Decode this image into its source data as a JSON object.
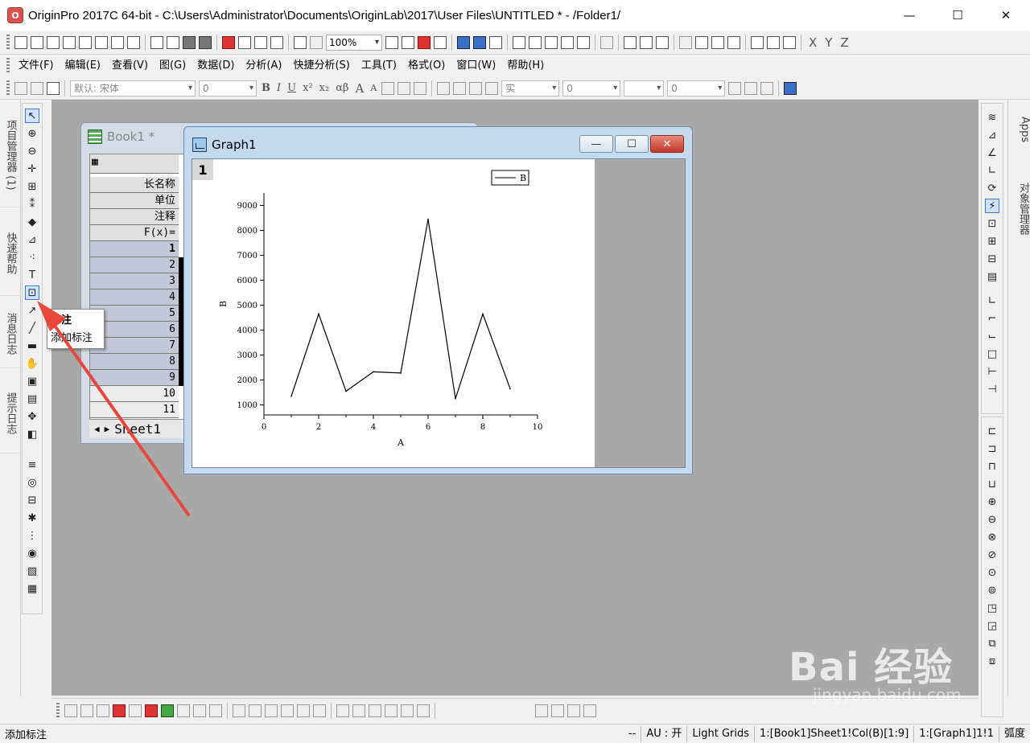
{
  "window": {
    "title": "OriginPro 2017C 64-bit - C:\\Users\\Administrator\\Documents\\OriginLab\\2017\\User Files\\UNTITLED * - /Folder1/",
    "minimize_symbol": "—",
    "maximize_symbol": "☐",
    "close_symbol": "✕"
  },
  "toolbar": {
    "zoom_value": "100%",
    "font_name": "默认: 宋体",
    "font_size": "0",
    "line_style": "实",
    "line_width": "0",
    "line_width_2": "0",
    "italic_label": "I",
    "bold_label": "B",
    "underline_label": "U",
    "superscript_label": "x²",
    "subscript_label": "x₂",
    "greek_label": "αβ",
    "increase_font_label": "A",
    "decrease_font_label": "A",
    "x_label": "X",
    "y_label": "Y",
    "z_label": "Z"
  },
  "menubar": {
    "items": [
      "文件(F)",
      "编辑(E)",
      "查看(V)",
      "图(G)",
      "数据(D)",
      "分析(A)",
      "快捷分析(S)",
      "工具(T)",
      "格式(O)",
      "窗口(W)",
      "帮助(H)"
    ]
  },
  "left_dock": {
    "tabs": [
      "项目管理器 (1)",
      "快速帮助",
      "消息日志",
      "提示日志"
    ]
  },
  "right_dock": {
    "tabs": [
      "Apps",
      "对象管理器"
    ]
  },
  "book": {
    "title": "Book1 *",
    "header_rows": [
      "长名称",
      "单位",
      "注释",
      "F(x)="
    ],
    "row_numbers": [
      "1",
      "2",
      "3",
      "4",
      "5",
      "6",
      "7",
      "8",
      "9",
      "10",
      "11"
    ],
    "sheet_tab": "Sheet1"
  },
  "graph": {
    "title": "Graph1",
    "layer_number": "1",
    "legend_label": "B"
  },
  "chart_data": {
    "type": "line",
    "title": "",
    "xlabel": "A",
    "ylabel": "B",
    "xlim": [
      0,
      10
    ],
    "ylim": [
      600,
      9500
    ],
    "xticks": [
      0,
      2,
      4,
      6,
      8,
      10
    ],
    "yticks": [
      1000,
      2000,
      3000,
      4000,
      5000,
      6000,
      7000,
      8000,
      9000
    ],
    "series": [
      {
        "name": "B",
        "x": [
          1,
          2,
          3,
          4,
          5,
          6,
          7,
          8,
          9
        ],
        "y": [
          1350,
          4650,
          1550,
          2330,
          2280,
          8450,
          1250,
          4650,
          1650
        ]
      }
    ],
    "grid": false,
    "legend_position": "top-right"
  },
  "tooltip": {
    "title": "标注",
    "description": "添加标注"
  },
  "statusbar": {
    "left": "添加标注",
    "dash": "--",
    "au": "AU : 开",
    "theme": "Light Grids",
    "selection": "1:[Book1]Sheet1!Col(B)[1:9]",
    "graph_ref": "1:[Graph1]1!1",
    "angle": "弧度"
  },
  "watermark": {
    "text": "Bai 经验",
    "url": "jingyan.baidu.com"
  }
}
